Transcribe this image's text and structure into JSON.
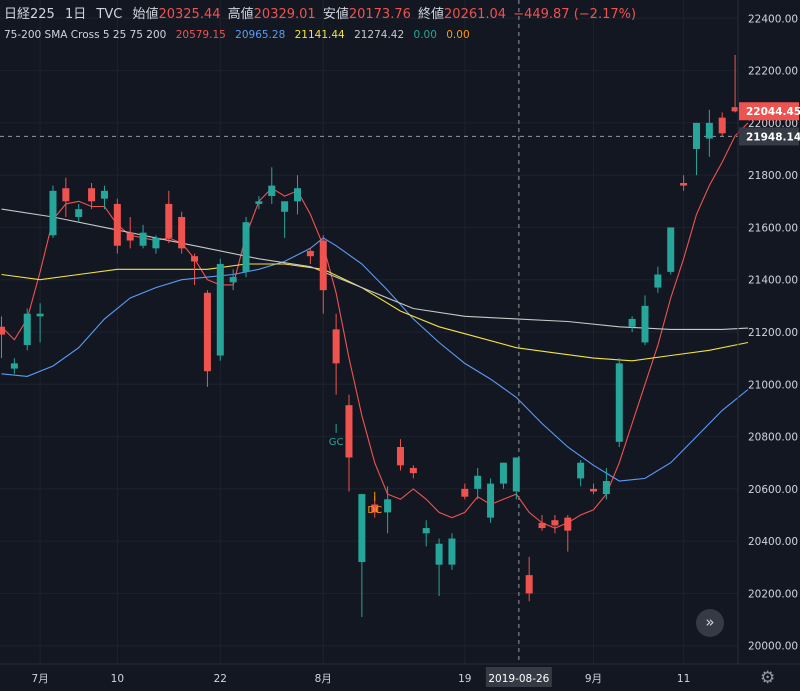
{
  "header": {
    "symbol": "日経225",
    "interval": "1日",
    "source": "TVC",
    "open_label": "始値",
    "open": "20325.44",
    "high_label": "高値",
    "high": "20329.01",
    "low_label": "安値",
    "low": "20173.76",
    "close_label": "終値",
    "close": "20261.04",
    "change": "−449.87 (−2.17%)"
  },
  "indicator": {
    "name": "75-200 SMA Cross 5 25 75 200",
    "v1": "20579.15",
    "v2": "20965.28",
    "v3": "21141.44",
    "v4": "21274.42",
    "v5": "0.00",
    "v6": "0.00"
  },
  "colors": {
    "background": "#131722",
    "up": "#26a69a",
    "down": "#ef5350",
    "sma5": "#ef5350",
    "sma25": "#5b9cf6",
    "sma75": "#f2e340",
    "sma200": "#c8c8c8",
    "text": "#d1d4dc"
  },
  "crosshair": {
    "date_label": "2019-08-26",
    "price_label": "21948.14"
  },
  "last_price_label": "22044.45",
  "icons": {
    "nav": "double-chevron-right-icon",
    "settings": "gear-icon"
  },
  "chart_data": {
    "type": "candlestick",
    "y_ticks": [
      "22400.00",
      "22200.00",
      "22000.00",
      "21800.00",
      "21600.00",
      "21400.00",
      "21200.00",
      "21000.00",
      "20800.00",
      "20600.00",
      "20400.00",
      "20200.00",
      "20000.00"
    ],
    "ylim": [
      19930,
      22470
    ],
    "x_ticks": [
      {
        "index": 3,
        "label": "7月"
      },
      {
        "index": 9,
        "label": "10"
      },
      {
        "index": 17,
        "label": "22"
      },
      {
        "index": 25,
        "label": "8月"
      },
      {
        "index": 36,
        "label": "19"
      },
      {
        "index": 46,
        "label": "9月"
      },
      {
        "index": 53,
        "label": "11"
      }
    ],
    "candles": [
      {
        "o": 21220,
        "h": 21260,
        "l": 21100,
        "c": 21190
      },
      {
        "o": 21060,
        "h": 21100,
        "l": 21040,
        "c": 21080
      },
      {
        "o": 21150,
        "h": 21290,
        "l": 21130,
        "c": 21270
      },
      {
        "o": 21260,
        "h": 21310,
        "l": 21160,
        "c": 21270
      },
      {
        "o": 21570,
        "h": 21760,
        "l": 21560,
        "c": 21740
      },
      {
        "o": 21750,
        "h": 21790,
        "l": 21640,
        "c": 21700
      },
      {
        "o": 21640,
        "h": 21690,
        "l": 21620,
        "c": 21670
      },
      {
        "o": 21750,
        "h": 21770,
        "l": 21670,
        "c": 21700
      },
      {
        "o": 21710,
        "h": 21760,
        "l": 21670,
        "c": 21740
      },
      {
        "o": 21690,
        "h": 21710,
        "l": 21500,
        "c": 21530
      },
      {
        "o": 21580,
        "h": 21640,
        "l": 21520,
        "c": 21550
      },
      {
        "o": 21530,
        "h": 21610,
        "l": 21520,
        "c": 21580
      },
      {
        "o": 21520,
        "h": 21570,
        "l": 21500,
        "c": 21560
      },
      {
        "o": 21690,
        "h": 21740,
        "l": 21540,
        "c": 21560
      },
      {
        "o": 21640,
        "h": 21660,
        "l": 21500,
        "c": 21520
      },
      {
        "o": 21490,
        "h": 21500,
        "l": 21380,
        "c": 21470
      },
      {
        "o": 21350,
        "h": 21360,
        "l": 20990,
        "c": 21050
      },
      {
        "o": 21110,
        "h": 21480,
        "l": 21090,
        "c": 21460
      },
      {
        "o": 21390,
        "h": 21440,
        "l": 21360,
        "c": 21410
      },
      {
        "o": 21430,
        "h": 21640,
        "l": 21410,
        "c": 21620
      },
      {
        "o": 21690,
        "h": 21720,
        "l": 21670,
        "c": 21700
      },
      {
        "o": 21720,
        "h": 21830,
        "l": 21690,
        "c": 21760
      },
      {
        "o": 21660,
        "h": 21700,
        "l": 21560,
        "c": 21700
      },
      {
        "o": 21700,
        "h": 21800,
        "l": 21650,
        "c": 21750
      },
      {
        "o": 21510,
        "h": 21520,
        "l": 21460,
        "c": 21490
      },
      {
        "o": 21550,
        "h": 21570,
        "l": 21270,
        "c": 21360
      },
      {
        "o": 21210,
        "h": 21270,
        "l": 20960,
        "c": 21080
      },
      {
        "o": 20920,
        "h": 20960,
        "l": 20590,
        "c": 20720
      },
      {
        "o": 20320,
        "h": 20580,
        "l": 20110,
        "c": 20580
      },
      {
        "o": 20540,
        "h": 20570,
        "l": 20490,
        "c": 20510
      },
      {
        "o": 20510,
        "h": 20610,
        "l": 20430,
        "c": 20560
      },
      {
        "o": 20760,
        "h": 20790,
        "l": 20670,
        "c": 20690
      },
      {
        "o": 20680,
        "h": 20690,
        "l": 20640,
        "c": 20660
      },
      {
        "o": 20430,
        "h": 20480,
        "l": 20380,
        "c": 20450
      },
      {
        "o": 20310,
        "h": 20410,
        "l": 20190,
        "c": 20390
      },
      {
        "o": 20310,
        "h": 20430,
        "l": 20290,
        "c": 20410
      },
      {
        "o": 20600,
        "h": 20620,
        "l": 20560,
        "c": 20570
      },
      {
        "o": 20600,
        "h": 20680,
        "l": 20560,
        "c": 20650
      },
      {
        "o": 20490,
        "h": 20640,
        "l": 20470,
        "c": 20620
      },
      {
        "o": 20620,
        "h": 20700,
        "l": 20600,
        "c": 20700
      },
      {
        "o": 20590,
        "h": 20720,
        "l": 20560,
        "c": 20720
      },
      {
        "o": 20270,
        "h": 20340,
        "l": 20170,
        "c": 20200
      },
      {
        "o": 20470,
        "h": 20500,
        "l": 20440,
        "c": 20450
      },
      {
        "o": 20480,
        "h": 20500,
        "l": 20430,
        "c": 20460
      },
      {
        "o": 20490,
        "h": 20500,
        "l": 20360,
        "c": 20440
      },
      {
        "o": 20640,
        "h": 20710,
        "l": 20610,
        "c": 20700
      },
      {
        "o": 20600,
        "h": 20620,
        "l": 20580,
        "c": 20590
      },
      {
        "o": 20580,
        "h": 20680,
        "l": 20560,
        "c": 20630
      },
      {
        "o": 20780,
        "h": 21100,
        "l": 20760,
        "c": 21080
      },
      {
        "o": 21220,
        "h": 21260,
        "l": 21200,
        "c": 21250
      },
      {
        "o": 21160,
        "h": 21340,
        "l": 21150,
        "c": 21300
      },
      {
        "o": 21370,
        "h": 21450,
        "l": 21350,
        "c": 21420
      },
      {
        "o": 21430,
        "h": 21580,
        "l": 21420,
        "c": 21600
      },
      {
        "o": 21770,
        "h": 21800,
        "l": 21740,
        "c": 21760
      },
      {
        "o": 21900,
        "h": 22000,
        "l": 21800,
        "c": 22000
      },
      {
        "o": 21940,
        "h": 22050,
        "l": 21870,
        "c": 22000
      },
      {
        "o": 22020,
        "h": 22040,
        "l": 21950,
        "c": 21960
      },
      {
        "o": 22060,
        "h": 22260,
        "l": 22040,
        "c": 22044
      }
    ],
    "series": [
      {
        "name": "SMA 5",
        "color": "#ef5350",
        "points": [
          [
            0,
            21220
          ],
          [
            1,
            21170
          ],
          [
            2,
            21250
          ],
          [
            3,
            21430
          ],
          [
            4,
            21630
          ],
          [
            5,
            21690
          ],
          [
            6,
            21700
          ],
          [
            7,
            21680
          ],
          [
            8,
            21680
          ],
          [
            9,
            21610
          ],
          [
            10,
            21570
          ],
          [
            11,
            21560
          ],
          [
            12,
            21550
          ],
          [
            13,
            21560
          ],
          [
            14,
            21540
          ],
          [
            15,
            21480
          ],
          [
            16,
            21400
          ],
          [
            17,
            21380
          ],
          [
            18,
            21380
          ],
          [
            19,
            21570
          ],
          [
            20,
            21700
          ],
          [
            21,
            21750
          ],
          [
            22,
            21720
          ],
          [
            23,
            21740
          ],
          [
            24,
            21650
          ],
          [
            25,
            21530
          ],
          [
            26,
            21350
          ],
          [
            27,
            21100
          ],
          [
            28,
            20880
          ],
          [
            29,
            20700
          ],
          [
            30,
            20580
          ],
          [
            31,
            20560
          ],
          [
            32,
            20600
          ],
          [
            33,
            20560
          ],
          [
            34,
            20510
          ],
          [
            35,
            20490
          ],
          [
            36,
            20510
          ],
          [
            37,
            20570
          ],
          [
            38,
            20540
          ],
          [
            39,
            20560
          ],
          [
            40,
            20580
          ],
          [
            41,
            20510
          ],
          [
            42,
            20470
          ],
          [
            43,
            20450
          ],
          [
            44,
            20470
          ],
          [
            45,
            20500
          ],
          [
            46,
            20520
          ],
          [
            47,
            20580
          ],
          [
            48,
            20700
          ],
          [
            49,
            20850
          ],
          [
            50,
            21000
          ],
          [
            51,
            21150
          ],
          [
            52,
            21330
          ],
          [
            53,
            21480
          ],
          [
            54,
            21650
          ],
          [
            55,
            21760
          ],
          [
            56,
            21850
          ],
          [
            57,
            21950
          ],
          [
            58,
            22000
          ]
        ]
      },
      {
        "name": "SMA 25",
        "color": "#5b9cf6",
        "points": [
          [
            0,
            21040
          ],
          [
            2,
            21030
          ],
          [
            4,
            21070
          ],
          [
            6,
            21140
          ],
          [
            8,
            21250
          ],
          [
            10,
            21330
          ],
          [
            12,
            21370
          ],
          [
            14,
            21400
          ],
          [
            16,
            21410
          ],
          [
            18,
            21420
          ],
          [
            20,
            21440
          ],
          [
            22,
            21470
          ],
          [
            24,
            21520
          ],
          [
            25,
            21560
          ],
          [
            26,
            21530
          ],
          [
            28,
            21460
          ],
          [
            30,
            21360
          ],
          [
            32,
            21250
          ],
          [
            34,
            21160
          ],
          [
            36,
            21080
          ],
          [
            38,
            21020
          ],
          [
            40,
            20950
          ],
          [
            42,
            20850
          ],
          [
            44,
            20760
          ],
          [
            46,
            20690
          ],
          [
            48,
            20630
          ],
          [
            50,
            20640
          ],
          [
            52,
            20700
          ],
          [
            54,
            20800
          ],
          [
            56,
            20900
          ],
          [
            58,
            20980
          ]
        ]
      },
      {
        "name": "SMA 75",
        "color": "#f2e340",
        "points": [
          [
            0,
            21420
          ],
          [
            3,
            21400
          ],
          [
            6,
            21420
          ],
          [
            9,
            21440
          ],
          [
            12,
            21440
          ],
          [
            16,
            21440
          ],
          [
            19,
            21460
          ],
          [
            22,
            21460
          ],
          [
            25,
            21440
          ],
          [
            28,
            21370
          ],
          [
            31,
            21280
          ],
          [
            34,
            21220
          ],
          [
            37,
            21180
          ],
          [
            40,
            21140
          ],
          [
            43,
            21120
          ],
          [
            46,
            21100
          ],
          [
            49,
            21090
          ],
          [
            52,
            21110
          ],
          [
            55,
            21130
          ],
          [
            58,
            21160
          ]
        ]
      },
      {
        "name": "SMA 200",
        "color": "#c8c8c8",
        "points": [
          [
            0,
            21670
          ],
          [
            4,
            21640
          ],
          [
            8,
            21600
          ],
          [
            12,
            21560
          ],
          [
            16,
            21520
          ],
          [
            20,
            21480
          ],
          [
            24,
            21450
          ],
          [
            28,
            21370
          ],
          [
            32,
            21290
          ],
          [
            36,
            21260
          ],
          [
            40,
            21250
          ],
          [
            44,
            21240
          ],
          [
            48,
            21220
          ],
          [
            52,
            21210
          ],
          [
            56,
            21210
          ],
          [
            58,
            21215
          ]
        ]
      }
    ],
    "annotations": [
      {
        "index": 26,
        "price": 20860,
        "label": "GC",
        "color": "#26a69a",
        "marker": "I"
      },
      {
        "index": 29,
        "price": 20600,
        "label": "DC",
        "color": "#ff9800",
        "marker": "I"
      }
    ]
  }
}
